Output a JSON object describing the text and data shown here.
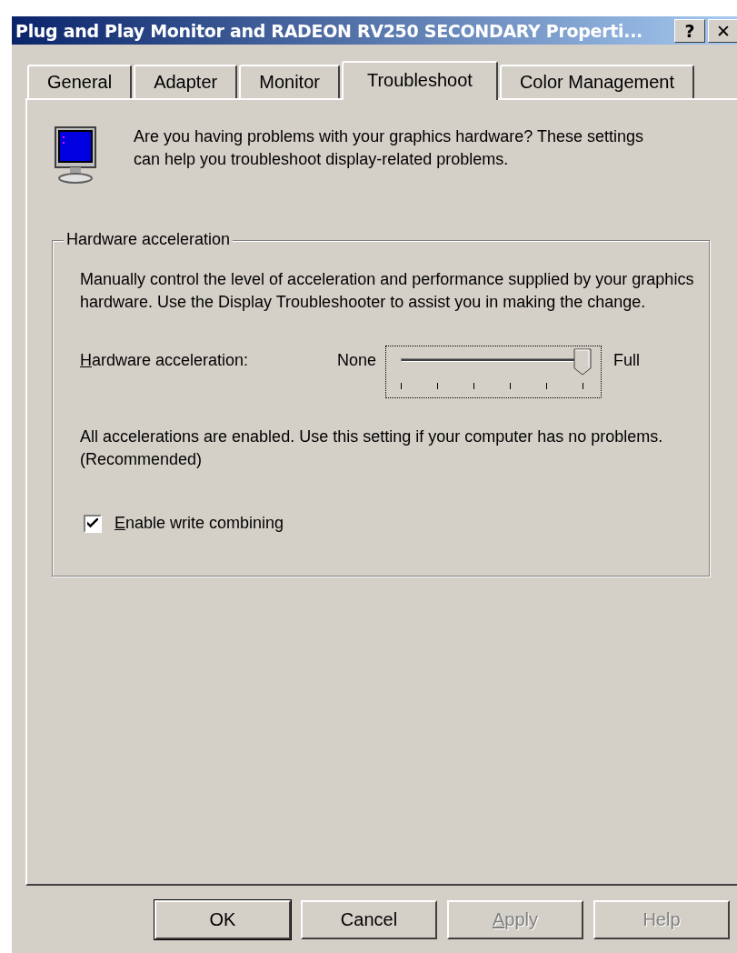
{
  "window": {
    "title": "Plug and Play Monitor and RADEON RV250 SECONDARY Properti...",
    "title_buttons": [
      "?",
      "✕"
    ]
  },
  "tabs": [
    {
      "label": "General",
      "selected": false
    },
    {
      "label": "Adapter",
      "selected": false
    },
    {
      "label": "Monitor",
      "selected": false
    },
    {
      "label": "Troubleshoot",
      "selected": true
    },
    {
      "label": "Color Management",
      "selected": false
    }
  ],
  "intro": "Are you having problems with your graphics hardware? These settings can help you troubleshoot display-related problems.",
  "group": {
    "legend": "Hardware acceleration",
    "description": " Manually control the level of acceleration and performance supplied by your graphics hardware. Use the Display Troubleshooter to assist you in making the change.",
    "slider": {
      "label": "Hardware acceleration:",
      "mnemonic": true,
      "min_label": "None",
      "max_label": "Full",
      "level": 1,
      "focused": true
    },
    "status": "All accelerations are enabled. Use this setting if your computer has no problems. (Recommended)",
    "checkbox": {
      "label": "Enable write combining",
      "mnemonic": true,
      "checked": true
    }
  },
  "buttons": [
    {
      "label": "OK",
      "default": true,
      "disabled": false
    },
    {
      "label": "Cancel",
      "default": false,
      "disabled": false
    },
    {
      "label": "Apply",
      "default": false,
      "disabled": true,
      "mnemonic": true
    },
    {
      "label": "Help",
      "default": false,
      "disabled": true
    }
  ]
}
